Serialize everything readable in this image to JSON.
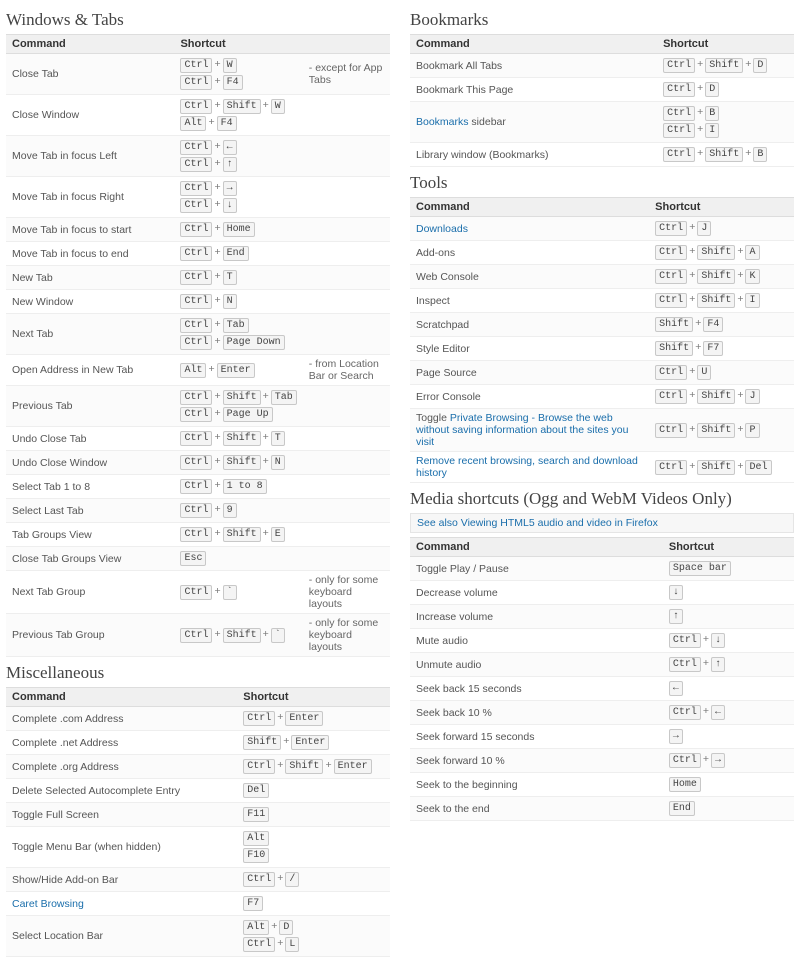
{
  "sections": {
    "windowsTabs": {
      "title": "Windows & Tabs",
      "headers": [
        "Command",
        "Shortcut",
        ""
      ],
      "rows": [
        {
          "cmd": "Close Tab",
          "sc": [
            [
              "Ctrl",
              "W"
            ],
            [
              "Ctrl",
              "F4"
            ]
          ],
          "note": "- except for App Tabs"
        },
        {
          "cmd": "Close Window",
          "sc": [
            [
              "Ctrl",
              "Shift",
              "W"
            ],
            [
              "Alt",
              "F4"
            ]
          ]
        },
        {
          "cmd": "Move Tab in focus Left",
          "sc": [
            [
              "Ctrl",
              "←"
            ],
            [
              "Ctrl",
              "↑"
            ]
          ]
        },
        {
          "cmd": "Move Tab in focus Right",
          "sc": [
            [
              "Ctrl",
              "→"
            ],
            [
              "Ctrl",
              "↓"
            ]
          ]
        },
        {
          "cmd": "Move Tab in focus to start",
          "sc": [
            [
              "Ctrl",
              "Home"
            ]
          ]
        },
        {
          "cmd": "Move Tab in focus to end",
          "sc": [
            [
              "Ctrl",
              "End"
            ]
          ]
        },
        {
          "cmd": "New Tab",
          "sc": [
            [
              "Ctrl",
              "T"
            ]
          ]
        },
        {
          "cmd": "New Window",
          "sc": [
            [
              "Ctrl",
              "N"
            ]
          ]
        },
        {
          "cmd": "Next Tab",
          "sc": [
            [
              "Ctrl",
              "Tab"
            ],
            [
              "Ctrl",
              "Page Down"
            ]
          ]
        },
        {
          "cmd": "Open Address in New Tab",
          "sc": [
            [
              "Alt",
              "Enter"
            ]
          ],
          "note": "- from Location Bar or Search"
        },
        {
          "cmd": "Previous Tab",
          "sc": [
            [
              "Ctrl",
              "Shift",
              "Tab"
            ],
            [
              "Ctrl",
              "Page Up"
            ]
          ]
        },
        {
          "cmd": "Undo Close Tab",
          "sc": [
            [
              "Ctrl",
              "Shift",
              "T"
            ]
          ]
        },
        {
          "cmd": "Undo Close Window",
          "sc": [
            [
              "Ctrl",
              "Shift",
              "N"
            ]
          ]
        },
        {
          "cmd": "Select Tab 1 to 8",
          "sc": [
            [
              "Ctrl",
              "1 to 8"
            ]
          ]
        },
        {
          "cmd": "Select Last Tab",
          "sc": [
            [
              "Ctrl",
              "9"
            ]
          ]
        },
        {
          "cmd": "Tab Groups View",
          "sc": [
            [
              "Ctrl",
              "Shift",
              "E"
            ]
          ]
        },
        {
          "cmd": "Close Tab Groups View",
          "sc": [
            [
              "Esc"
            ]
          ]
        },
        {
          "cmd": "Next Tab Group",
          "sc": [
            [
              "Ctrl",
              "`"
            ]
          ],
          "note": "- only for some keyboard layouts"
        },
        {
          "cmd": "Previous Tab Group",
          "sc": [
            [
              "Ctrl",
              "Shift",
              "`"
            ]
          ],
          "note": "- only for some keyboard layouts"
        }
      ]
    },
    "misc": {
      "title": "Miscellaneous",
      "headers": [
        "Command",
        "Shortcut"
      ],
      "rows": [
        {
          "cmd": "Complete .com Address",
          "sc": [
            [
              "Ctrl",
              "Enter"
            ]
          ]
        },
        {
          "cmd": "Complete .net Address",
          "sc": [
            [
              "Shift",
              "Enter"
            ]
          ]
        },
        {
          "cmd": "Complete .org Address",
          "sc": [
            [
              "Ctrl",
              "Shift",
              "Enter"
            ]
          ]
        },
        {
          "cmd": "Delete Selected Autocomplete Entry",
          "sc": [
            [
              "Del"
            ]
          ]
        },
        {
          "cmd": "Toggle Full Screen",
          "sc": [
            [
              "F11"
            ]
          ]
        },
        {
          "cmd": "Toggle Menu Bar (when hidden)",
          "sc": [
            [
              "Alt"
            ],
            [
              "F10"
            ]
          ]
        },
        {
          "cmd": "Show/Hide Add-on Bar",
          "sc": [
            [
              "Ctrl",
              "/"
            ]
          ]
        },
        {
          "cmd": "Caret Browsing",
          "link": true,
          "sc": [
            [
              "F7"
            ]
          ]
        },
        {
          "cmd": "Select Location Bar",
          "sc": [
            [
              "Alt",
              "D"
            ],
            [
              "Ctrl",
              "L"
            ]
          ]
        }
      ]
    },
    "bookmarks": {
      "title": "Bookmarks",
      "headers": [
        "Command",
        "Shortcut"
      ],
      "rows": [
        {
          "cmd": "Bookmark All Tabs",
          "sc": [
            [
              "Ctrl",
              "Shift",
              "D"
            ]
          ]
        },
        {
          "cmd": "Bookmark This Page",
          "sc": [
            [
              "Ctrl",
              "D"
            ]
          ]
        },
        {
          "cmdhtml": [
            {
              "t": "Bookmarks",
              "link": true
            },
            {
              "t": " sidebar"
            }
          ],
          "sc": [
            [
              "Ctrl",
              "B"
            ],
            [
              "Ctrl",
              "I"
            ]
          ]
        },
        {
          "cmd": "Library window (Bookmarks)",
          "sc": [
            [
              "Ctrl",
              "Shift",
              "B"
            ]
          ]
        }
      ]
    },
    "tools": {
      "title": "Tools",
      "headers": [
        "Command",
        "Shortcut"
      ],
      "rows": [
        {
          "cmd": "Downloads",
          "link": true,
          "sc": [
            [
              "Ctrl",
              "J"
            ]
          ]
        },
        {
          "cmd": "Add-ons",
          "sc": [
            [
              "Ctrl",
              "Shift",
              "A"
            ]
          ]
        },
        {
          "cmd": "Web Console",
          "sc": [
            [
              "Ctrl",
              "Shift",
              "K"
            ]
          ]
        },
        {
          "cmd": "Inspect",
          "sc": [
            [
              "Ctrl",
              "Shift",
              "I"
            ]
          ]
        },
        {
          "cmd": "Scratchpad",
          "sc": [
            [
              "Shift",
              "F4"
            ]
          ]
        },
        {
          "cmd": "Style Editor",
          "sc": [
            [
              "Shift",
              "F7"
            ]
          ]
        },
        {
          "cmd": "Page Source",
          "sc": [
            [
              "Ctrl",
              "U"
            ]
          ]
        },
        {
          "cmd": "Error Console",
          "sc": [
            [
              "Ctrl",
              "Shift",
              "J"
            ]
          ]
        },
        {
          "cmdhtml": [
            {
              "t": "Toggle "
            },
            {
              "t": "Private Browsing - Browse the web without saving information about the sites you visit",
              "link": true
            }
          ],
          "sc": [
            [
              "Ctrl",
              "Shift",
              "P"
            ]
          ]
        },
        {
          "cmdhtml": [
            {
              "t": "Remove recent browsing, search and download history",
              "link": true
            }
          ],
          "sc": [
            [
              "Ctrl",
              "Shift",
              "Del"
            ]
          ]
        }
      ]
    },
    "media": {
      "title": "Media shortcuts (Ogg and WebM Videos Only)",
      "info": "See also Viewing HTML5 audio and video in Firefox",
      "headers": [
        "Command",
        "Shortcut"
      ],
      "rows": [
        {
          "cmd": "Toggle Play / Pause",
          "sc": [
            [
              "Space bar"
            ]
          ]
        },
        {
          "cmd": "Decrease volume",
          "sc": [
            [
              "↓"
            ]
          ]
        },
        {
          "cmd": "Increase volume",
          "sc": [
            [
              "↑"
            ]
          ]
        },
        {
          "cmd": "Mute audio",
          "sc": [
            [
              "Ctrl",
              "↓"
            ]
          ]
        },
        {
          "cmd": "Unmute audio",
          "sc": [
            [
              "Ctrl",
              "↑"
            ]
          ]
        },
        {
          "cmd": "Seek back 15 seconds",
          "sc": [
            [
              "←"
            ]
          ]
        },
        {
          "cmd": "Seek back 10 %",
          "sc": [
            [
              "Ctrl",
              "←"
            ]
          ]
        },
        {
          "cmd": "Seek forward 15 seconds",
          "sc": [
            [
              "→"
            ]
          ]
        },
        {
          "cmd": "Seek forward 10 %",
          "sc": [
            [
              "Ctrl",
              "→"
            ]
          ]
        },
        {
          "cmd": "Seek to the beginning",
          "sc": [
            [
              "Home"
            ]
          ]
        },
        {
          "cmd": "Seek to the end",
          "sc": [
            [
              "End"
            ]
          ]
        }
      ]
    }
  }
}
